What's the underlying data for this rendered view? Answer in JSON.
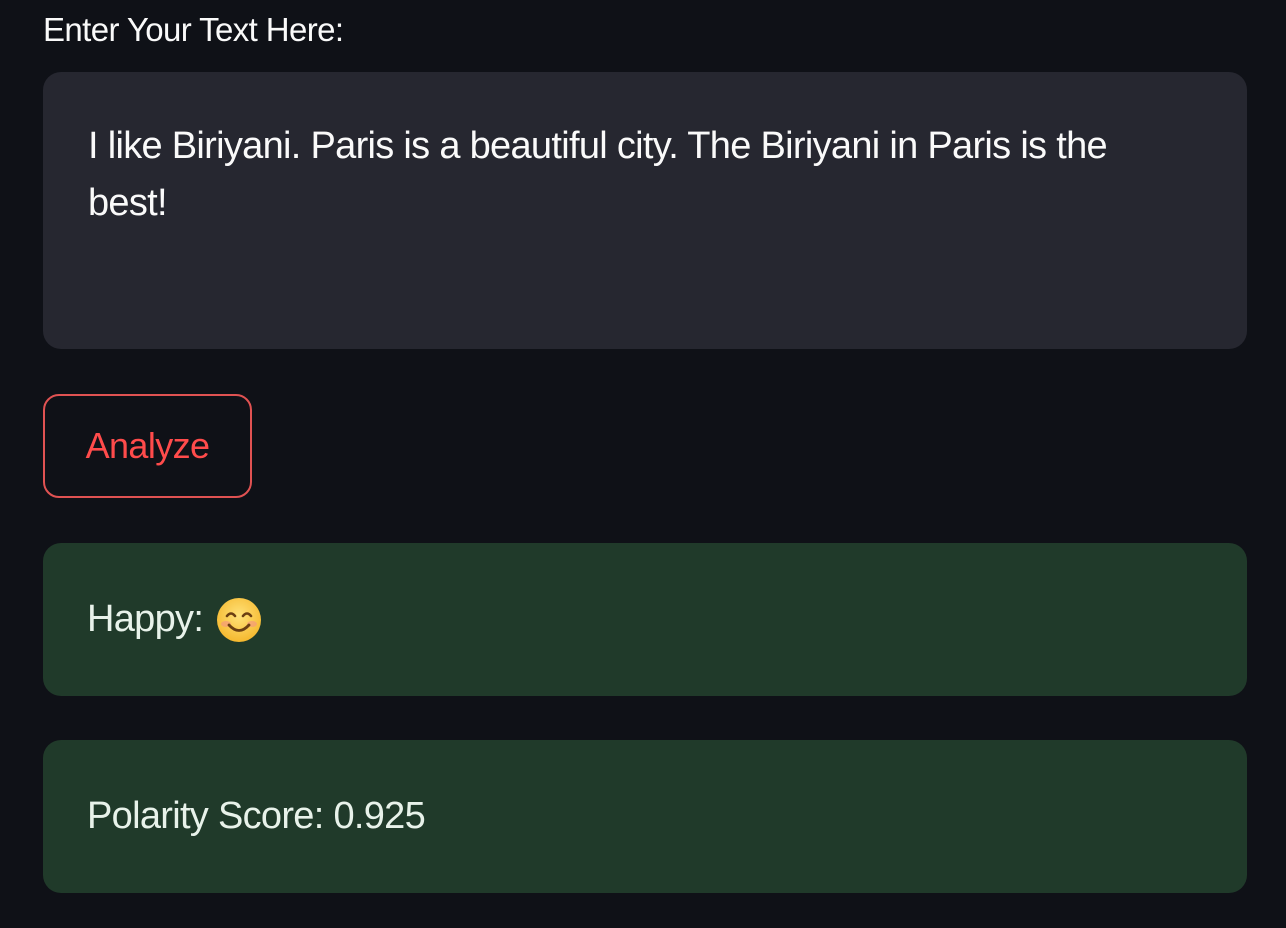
{
  "input": {
    "label": "Enter Your Text Here:",
    "value": "I like Biriyani. Paris is a beautiful city. The Biriyani in Paris is the best!"
  },
  "analyze_button": {
    "label": "Analyze"
  },
  "results": {
    "sentiment_label": "Happy:",
    "sentiment_icon": "smiling-face-icon",
    "polarity_text": "Polarity Score: 0.925"
  },
  "colors": {
    "background": "#0f1117",
    "input_background": "#262730",
    "button_accent": "#ff4b4b",
    "success_background": "#203a2a"
  }
}
